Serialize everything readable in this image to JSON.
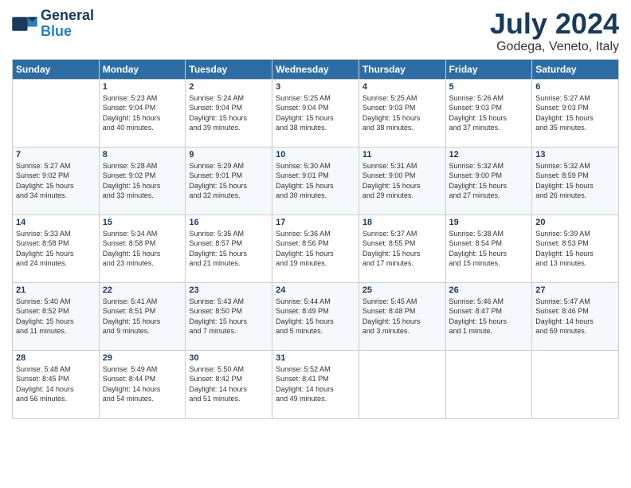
{
  "header": {
    "logo_line1": "General",
    "logo_line2": "Blue",
    "month_year": "July 2024",
    "location": "Godega, Veneto, Italy"
  },
  "columns": [
    "Sunday",
    "Monday",
    "Tuesday",
    "Wednesday",
    "Thursday",
    "Friday",
    "Saturday"
  ],
  "weeks": [
    [
      {
        "day": "",
        "content": ""
      },
      {
        "day": "1",
        "content": "Sunrise: 5:23 AM\nSunset: 9:04 PM\nDaylight: 15 hours\nand 40 minutes."
      },
      {
        "day": "2",
        "content": "Sunrise: 5:24 AM\nSunset: 9:04 PM\nDaylight: 15 hours\nand 39 minutes."
      },
      {
        "day": "3",
        "content": "Sunrise: 5:25 AM\nSunset: 9:04 PM\nDaylight: 15 hours\nand 38 minutes."
      },
      {
        "day": "4",
        "content": "Sunrise: 5:25 AM\nSunset: 9:03 PM\nDaylight: 15 hours\nand 38 minutes."
      },
      {
        "day": "5",
        "content": "Sunrise: 5:26 AM\nSunset: 9:03 PM\nDaylight: 15 hours\nand 37 minutes."
      },
      {
        "day": "6",
        "content": "Sunrise: 5:27 AM\nSunset: 9:03 PM\nDaylight: 15 hours\nand 35 minutes."
      }
    ],
    [
      {
        "day": "7",
        "content": "Sunrise: 5:27 AM\nSunset: 9:02 PM\nDaylight: 15 hours\nand 34 minutes."
      },
      {
        "day": "8",
        "content": "Sunrise: 5:28 AM\nSunset: 9:02 PM\nDaylight: 15 hours\nand 33 minutes."
      },
      {
        "day": "9",
        "content": "Sunrise: 5:29 AM\nSunset: 9:01 PM\nDaylight: 15 hours\nand 32 minutes."
      },
      {
        "day": "10",
        "content": "Sunrise: 5:30 AM\nSunset: 9:01 PM\nDaylight: 15 hours\nand 30 minutes."
      },
      {
        "day": "11",
        "content": "Sunrise: 5:31 AM\nSunset: 9:00 PM\nDaylight: 15 hours\nand 29 minutes."
      },
      {
        "day": "12",
        "content": "Sunrise: 5:32 AM\nSunset: 9:00 PM\nDaylight: 15 hours\nand 27 minutes."
      },
      {
        "day": "13",
        "content": "Sunrise: 5:32 AM\nSunset: 8:59 PM\nDaylight: 15 hours\nand 26 minutes."
      }
    ],
    [
      {
        "day": "14",
        "content": "Sunrise: 5:33 AM\nSunset: 8:58 PM\nDaylight: 15 hours\nand 24 minutes."
      },
      {
        "day": "15",
        "content": "Sunrise: 5:34 AM\nSunset: 8:58 PM\nDaylight: 15 hours\nand 23 minutes."
      },
      {
        "day": "16",
        "content": "Sunrise: 5:35 AM\nSunset: 8:57 PM\nDaylight: 15 hours\nand 21 minutes."
      },
      {
        "day": "17",
        "content": "Sunrise: 5:36 AM\nSunset: 8:56 PM\nDaylight: 15 hours\nand 19 minutes."
      },
      {
        "day": "18",
        "content": "Sunrise: 5:37 AM\nSunset: 8:55 PM\nDaylight: 15 hours\nand 17 minutes."
      },
      {
        "day": "19",
        "content": "Sunrise: 5:38 AM\nSunset: 8:54 PM\nDaylight: 15 hours\nand 15 minutes."
      },
      {
        "day": "20",
        "content": "Sunrise: 5:39 AM\nSunset: 8:53 PM\nDaylight: 15 hours\nand 13 minutes."
      }
    ],
    [
      {
        "day": "21",
        "content": "Sunrise: 5:40 AM\nSunset: 8:52 PM\nDaylight: 15 hours\nand 11 minutes."
      },
      {
        "day": "22",
        "content": "Sunrise: 5:41 AM\nSunset: 8:51 PM\nDaylight: 15 hours\nand 9 minutes."
      },
      {
        "day": "23",
        "content": "Sunrise: 5:43 AM\nSunset: 8:50 PM\nDaylight: 15 hours\nand 7 minutes."
      },
      {
        "day": "24",
        "content": "Sunrise: 5:44 AM\nSunset: 8:49 PM\nDaylight: 15 hours\nand 5 minutes."
      },
      {
        "day": "25",
        "content": "Sunrise: 5:45 AM\nSunset: 8:48 PM\nDaylight: 15 hours\nand 3 minutes."
      },
      {
        "day": "26",
        "content": "Sunrise: 5:46 AM\nSunset: 8:47 PM\nDaylight: 15 hours\nand 1 minute."
      },
      {
        "day": "27",
        "content": "Sunrise: 5:47 AM\nSunset: 8:46 PM\nDaylight: 14 hours\nand 59 minutes."
      }
    ],
    [
      {
        "day": "28",
        "content": "Sunrise: 5:48 AM\nSunset: 8:45 PM\nDaylight: 14 hours\nand 56 minutes."
      },
      {
        "day": "29",
        "content": "Sunrise: 5:49 AM\nSunset: 8:44 PM\nDaylight: 14 hours\nand 54 minutes."
      },
      {
        "day": "30",
        "content": "Sunrise: 5:50 AM\nSunset: 8:42 PM\nDaylight: 14 hours\nand 51 minutes."
      },
      {
        "day": "31",
        "content": "Sunrise: 5:52 AM\nSunset: 8:41 PM\nDaylight: 14 hours\nand 49 minutes."
      },
      {
        "day": "",
        "content": ""
      },
      {
        "day": "",
        "content": ""
      },
      {
        "day": "",
        "content": ""
      }
    ]
  ]
}
